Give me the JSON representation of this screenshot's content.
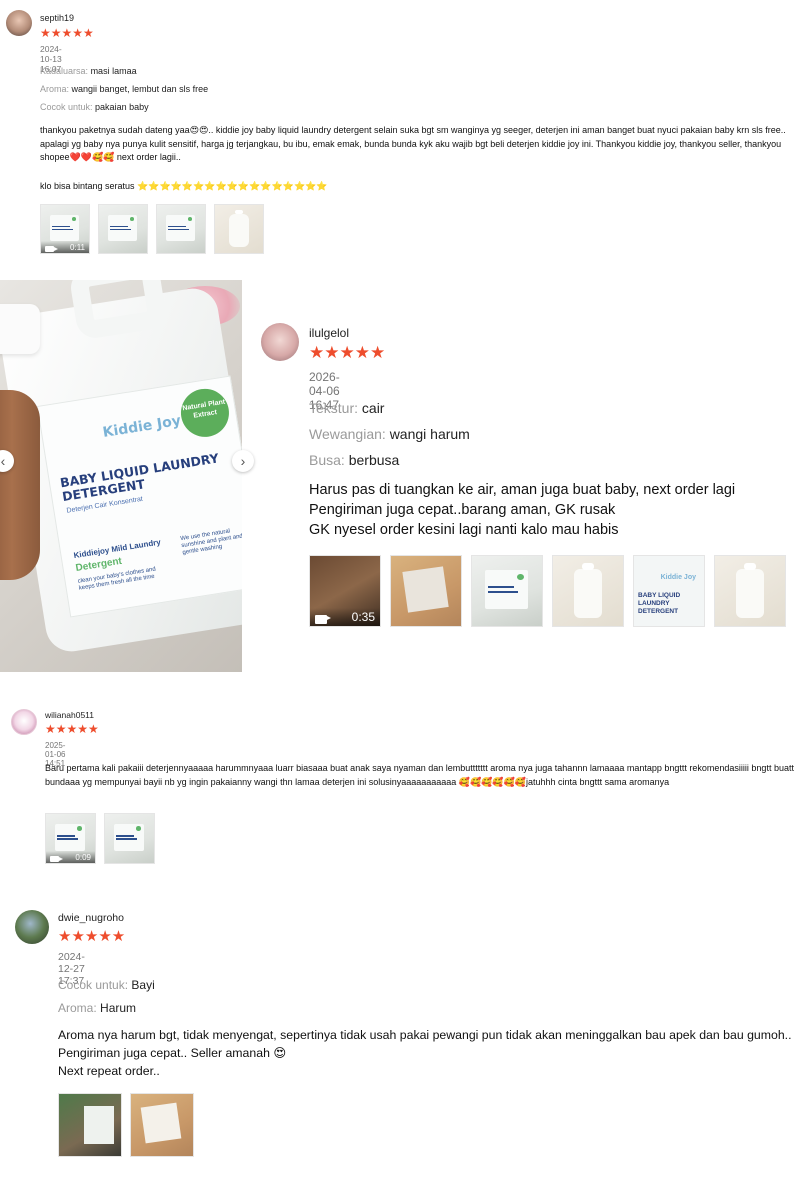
{
  "reviews": [
    {
      "username": "septih19",
      "stars": "★★★★★",
      "date": "2024-10-13 16:07",
      "attributes": [
        {
          "key": "Kadaluarsa:",
          "value": "masi lamaa"
        },
        {
          "key": "Aroma:",
          "value": "wangii banget, lembut dan sls free"
        },
        {
          "key": "Cocok untuk:",
          "value": "pakaian baby"
        }
      ],
      "text": "thankyou paketnya sudah dateng yaa😍😍.. kiddie joy baby liquid laundry detergent selain suka bgt sm wanginya yg seeger, deterjen ini aman banget buat nyuci pakaian baby krn sls free.. apalagi yg baby nya punya kulit sensitif, harga jg terjangkau, bu ibu, emak emak, bunda bunda kyk aku wajib bgt beli deterjen kiddie joy ini. Thankyou kiddie joy, thankyou seller, thankyou shopee❤️❤️🥰🥰 next order lagii..",
      "text2": "klo bisa bintang seratus ⭐⭐⭐⭐⭐⭐⭐⭐⭐⭐⭐⭐⭐⭐⭐⭐⭐",
      "video_duration": "0:11"
    },
    {
      "username": "ilulgelol",
      "stars": "★★★★★",
      "date": "2026-04-06 16:47",
      "attributes": [
        {
          "key": "Tekstur:",
          "value": "cair"
        },
        {
          "key": "Wewangian:",
          "value": "wangi harum"
        },
        {
          "key": "Busa:",
          "value": "berbusa"
        }
      ],
      "lines": [
        "Harus pas di tuangkan ke air, aman juga buat baby, next order lagi",
        "Pengiriman juga cepat..barang aman, GK rusak",
        "GK nyesel order kesini lagi nanti kalo mau habis"
      ],
      "video_duration": "0:35"
    },
    {
      "username": "wilianah0511",
      "stars": "★★★★★",
      "date": "2025-01-06 14:51",
      "text": "Baru pertama kali pakaiii deterjennyaaaaa harummnyaaa luarr biasaaa buat anak saya nyaman dan lembuttttttt aroma nya juga tahannn lamaaaa mantapp bngttt rekomendasiiiii bngtt buatt bundaaa yg mempunyai bayii nb yg ingin pakaianny wangi thn lamaa deterjen ini solusinyaaaaaaaaaaa 🥰🥰🥰🥰🥰🥰jatuhhh cinta bngttt sama aromanya",
      "video_duration": "0:09"
    },
    {
      "username": "dwie_nugroho",
      "stars": "★★★★★",
      "date": "2024-12-27 17:37",
      "attributes": [
        {
          "key": "Cocok untuk:",
          "value": "Bayi"
        },
        {
          "key": "Aroma:",
          "value": "Harum"
        }
      ],
      "lines": [
        "Aroma nya harum bgt, tidak menyengat, sepertinya tidak usah pakai pewangi pun tidak akan meninggalkan bau apek dan bau gumoh..",
        "Pengiriman juga cepat.. Seller amanah 😍",
        "Next repeat order.."
      ]
    }
  ],
  "product_image": {
    "badge": "Natural Plant Extract",
    "brand": "Kiddie Joy",
    "title": "BABY LIQUID LAUNDRY DETERGENT",
    "subtitle": "Deterjen Cair Konsentrat",
    "mild_line1": "Kiddiejoy Mild Laundry",
    "mild_line2": "Detergent",
    "desc": "clean your baby's clothes and keeps them fresh all the time",
    "desc2": "We use the natural sunshine and plant and gentle washing"
  },
  "thumb_labels": {
    "brand": "Kiddie Joy",
    "title": "BABY LIQUID LAUNDRY DETERGENT"
  },
  "nav": {
    "prev": "‹",
    "next": "›"
  },
  "colors": {
    "star": "#ee4d2d",
    "muted": "#9a9a9a",
    "date": "#757575"
  }
}
